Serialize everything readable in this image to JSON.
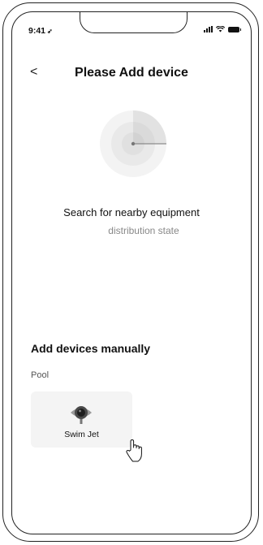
{
  "status_bar": {
    "time": "9:41",
    "location_glyph": "➶",
    "icons": [
      "signal-icon",
      "wifi-icon",
      "battery-icon"
    ]
  },
  "header": {
    "back_glyph": "<",
    "title": "Please Add device"
  },
  "search": {
    "title": "Search for nearby equipment",
    "subtitle": "distribution state"
  },
  "manual": {
    "title": "Add devices manually",
    "category": "Pool",
    "devices": [
      {
        "label": "Swim Jet",
        "icon": "swim-jet-icon"
      }
    ]
  },
  "cursor": "hand-pointer-icon"
}
